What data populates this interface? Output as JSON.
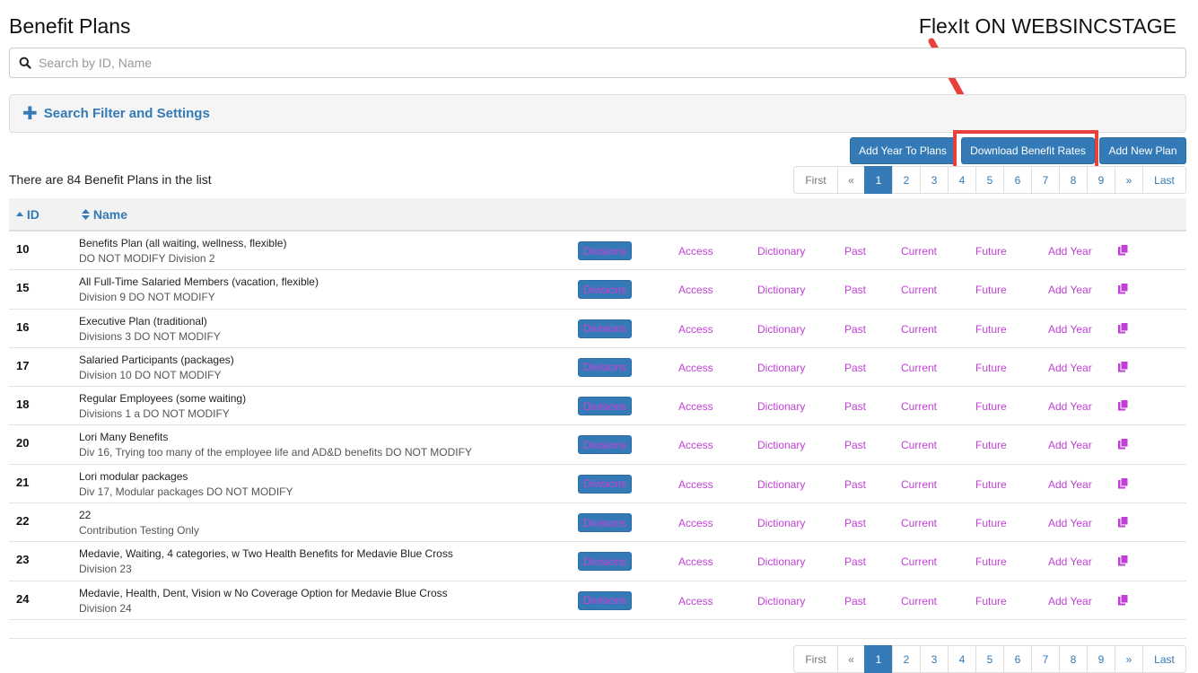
{
  "page": {
    "title": "Benefit Plans",
    "annotation": "FlexIt ON WEBSINCSTAGE"
  },
  "search": {
    "placeholder": "Search by ID, Name",
    "value": ""
  },
  "filter": {
    "label": "Search Filter and Settings",
    "icon": "plus-icon"
  },
  "actions": {
    "add_year_to_plans": "Add Year To Plans",
    "download_benefit_rates": "Download Benefit Rates",
    "add_new_plan": "Add New Plan"
  },
  "summary": {
    "text": "There are 84 Benefit Plans in the list"
  },
  "pagination": {
    "first": "First",
    "prev": "«",
    "next": "»",
    "last": "Last",
    "pages": [
      "1",
      "2",
      "3",
      "4",
      "5",
      "6",
      "7",
      "8",
      "9"
    ],
    "current": "1"
  },
  "table": {
    "columns": {
      "id": "ID",
      "name": "Name"
    },
    "row_actions": {
      "divisions": "Divisions",
      "access": "Access",
      "dictionary": "Dictionary",
      "past": "Past",
      "current": "Current",
      "future": "Future",
      "add_year": "Add Year"
    },
    "rows": [
      {
        "id": "10",
        "name": "Benefits Plan (all waiting, wellness, flexible)",
        "desc": "DO NOT MODIFY Division 2"
      },
      {
        "id": "15",
        "name": "All Full-Time Salaried Members (vacation, flexible)",
        "desc": "Division 9 DO NOT MODIFY"
      },
      {
        "id": "16",
        "name": "Executive Plan (traditional)",
        "desc": "Divisions 3 DO NOT MODIFY"
      },
      {
        "id": "17",
        "name": "Salaried Participants (packages)",
        "desc": "Division 10 DO NOT MODIFY"
      },
      {
        "id": "18",
        "name": "Regular Employees (some waiting)",
        "desc": "Divisions 1 a DO NOT MODIFY"
      },
      {
        "id": "20",
        "name": "Lori Many Benefits",
        "desc": "Div 16, Trying too many of the employee life and AD&D benefits DO NOT MODIFY"
      },
      {
        "id": "21",
        "name": "Lori modular packages",
        "desc": "Div 17, Modular packages DO NOT MODIFY"
      },
      {
        "id": "22",
        "name": "22",
        "desc": "Contribution Testing Only"
      },
      {
        "id": "23",
        "name": "Medavie, Waiting, 4 categories, w Two Health Benefits for Medavie Blue Cross",
        "desc": "Division 23"
      },
      {
        "id": "24",
        "name": "Medavie, Health, Dent, Vision w No Coverage Option for Medavie Blue Cross",
        "desc": "Division 24"
      }
    ]
  },
  "colors": {
    "primary": "#337ab7",
    "link": "#c13fd6",
    "highlight": "#e8403a"
  }
}
